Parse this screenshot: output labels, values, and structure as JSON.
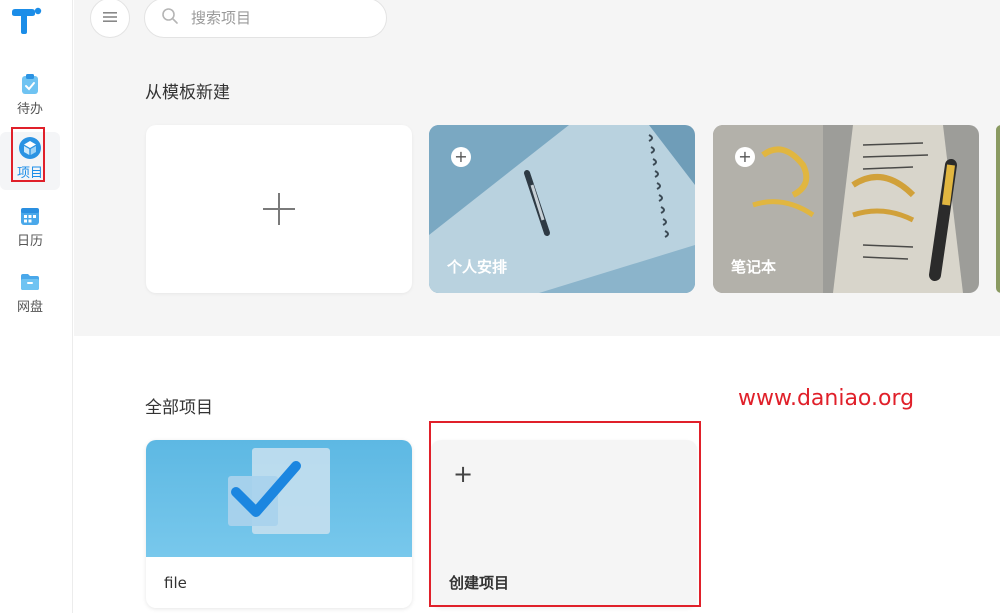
{
  "sidebar": {
    "logo": "t-logo-icon",
    "items": [
      {
        "label": "待办",
        "icon": "todo-clipboard-icon",
        "active": false
      },
      {
        "label": "项目",
        "icon": "project-cube-icon",
        "active": true
      },
      {
        "label": "日历",
        "icon": "calendar-icon",
        "active": false
      },
      {
        "label": "网盘",
        "icon": "folder-drive-icon",
        "active": false
      }
    ]
  },
  "header": {
    "menu_icon": "hamburger-menu-icon",
    "search": {
      "placeholder": "搜索项目",
      "value": "",
      "icon": "search-icon"
    }
  },
  "templates": {
    "title": "从模板新建",
    "cards": [
      {
        "label": "",
        "type": "blank",
        "icon": "plus-icon"
      },
      {
        "label": "个人安排",
        "type": "template",
        "icon": "add-circle-icon"
      },
      {
        "label": "笔记本",
        "type": "template",
        "icon": "add-circle-icon"
      }
    ]
  },
  "projects": {
    "title": "全部项目",
    "items": [
      {
        "label": "file",
        "icon": "checkmark-icon"
      }
    ],
    "create": {
      "label": "创建项目",
      "icon": "plus-icon"
    }
  },
  "watermark": "www.daniao.org",
  "colors": {
    "accent": "#1b8de8",
    "highlight_red": "#e0202a",
    "top_bg": "#f5f5f5",
    "file_card_blue": "#5db8e3"
  }
}
